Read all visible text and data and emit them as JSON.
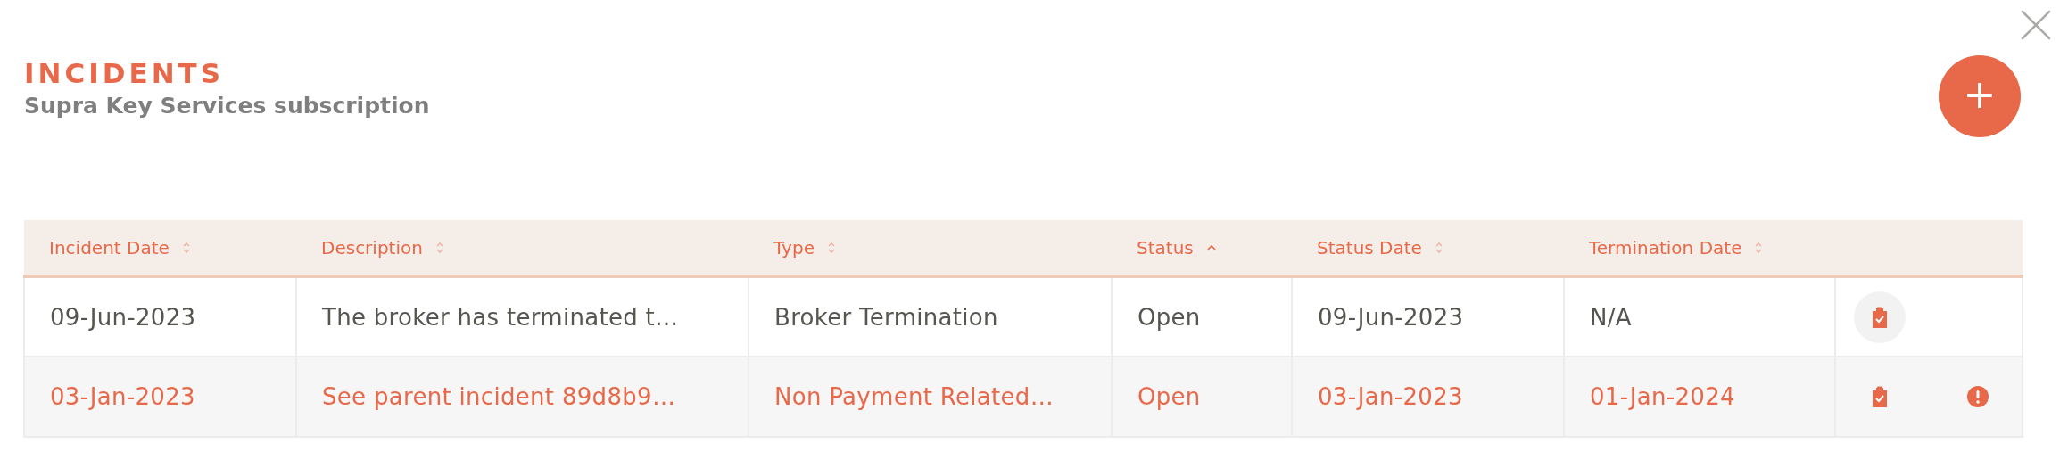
{
  "header": {
    "title": "INCIDENTS",
    "subtitle": "Supra Key Services subscription",
    "add_button": "+"
  },
  "table": {
    "columns": [
      {
        "label": "Incident Date",
        "sorted": false
      },
      {
        "label": "Description",
        "sorted": false
      },
      {
        "label": "Type",
        "sorted": false
      },
      {
        "label": "Status",
        "sorted": true
      },
      {
        "label": "Status Date",
        "sorted": false
      },
      {
        "label": "Termination Date",
        "sorted": false
      }
    ],
    "rows": [
      {
        "alert": false,
        "cells": [
          "09-Jun-2023",
          "The broker has terminated t…",
          "Broker Termination",
          "Open",
          "09-Jun-2023",
          "N/A"
        ],
        "actions": [
          {
            "kind": "clipboard",
            "hovered": true
          }
        ]
      },
      {
        "alert": true,
        "cells": [
          "03-Jan-2023",
          "See parent incident 89d8b9…",
          "Non Payment Related…",
          "Open",
          "03-Jan-2023",
          "01-Jan-2024"
        ],
        "actions": [
          {
            "kind": "clipboard",
            "hovered": false
          },
          {
            "kind": "alert",
            "hovered": false
          }
        ]
      }
    ]
  }
}
